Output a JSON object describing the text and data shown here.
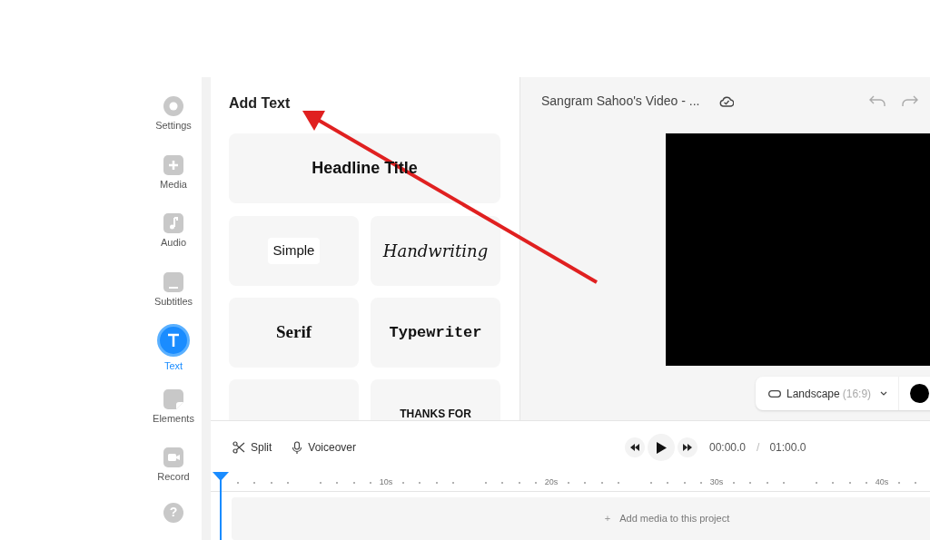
{
  "sidebar": {
    "items": [
      {
        "label": "Settings",
        "selected": false
      },
      {
        "label": "Media",
        "selected": false
      },
      {
        "label": "Audio",
        "selected": false
      },
      {
        "label": "Subtitles",
        "selected": false
      },
      {
        "label": "Text",
        "selected": true
      },
      {
        "label": "Elements",
        "selected": false
      },
      {
        "label": "Record",
        "selected": false
      }
    ],
    "help": "?"
  },
  "panel": {
    "title": "Add Text",
    "headline": "Headline Title",
    "styles": [
      {
        "label": "Simple",
        "kind": "simple"
      },
      {
        "label": "Handwriting",
        "kind": "handwriting"
      },
      {
        "label": "Serif",
        "kind": "serif"
      },
      {
        "label": "Typewriter",
        "kind": "typewriter"
      },
      {
        "kind": "blank"
      },
      {
        "label": "THANKS FOR",
        "kind": "caps"
      }
    ]
  },
  "preview": {
    "title": "Sangram Sahoo's Video - ...",
    "aspect": {
      "label": "Landscape",
      "ratio": "(16:9)"
    }
  },
  "timeline": {
    "tools": [
      {
        "label": "Split"
      },
      {
        "label": "Voiceover"
      }
    ],
    "current_time": "00:00.0",
    "separator": "/",
    "total_time": "01:00.0",
    "ruler": [
      "10s",
      "20s",
      "30s",
      "40s"
    ],
    "track_hint": "+",
    "track_label": "Add media to this project"
  }
}
